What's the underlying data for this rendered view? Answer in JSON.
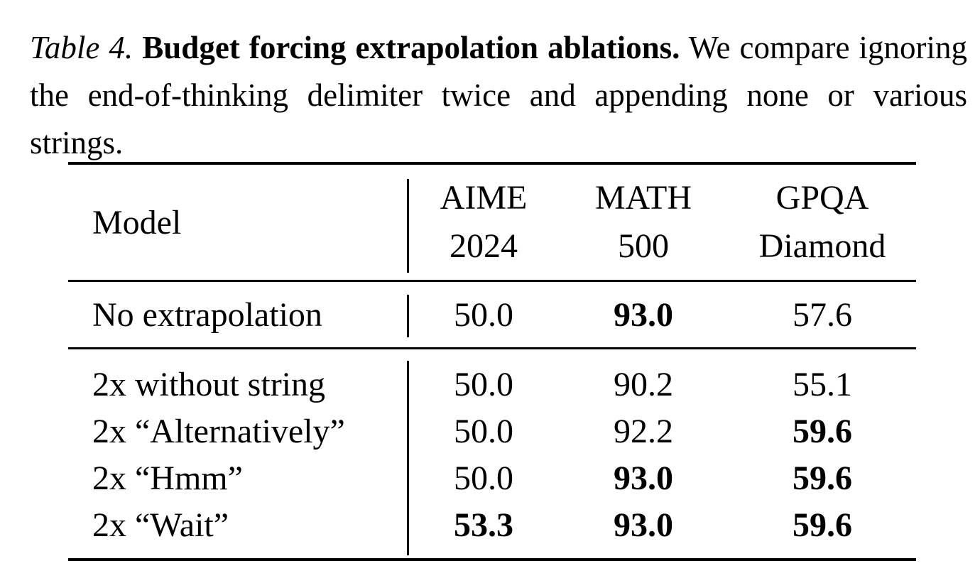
{
  "caption": {
    "label": "Table 4.",
    "title": "Budget forcing extrapolation ablations.",
    "text": "We compare ignoring the end-of-thinking delimiter twice and appending none or various strings."
  },
  "table": {
    "header": {
      "model": "Model",
      "col1_line1": "AIME",
      "col1_line2": "2024",
      "col2_line1": "MATH",
      "col2_line2": "500",
      "col3_line1": "GPQA",
      "col3_line2": "Diamond"
    },
    "rows": [
      {
        "model": "No extrapolation",
        "aime": "50.0",
        "math": "93.0",
        "gpqa": "57.6"
      },
      {
        "model": "2x without string",
        "aime": "50.0",
        "math": "90.2",
        "gpqa": "55.1"
      },
      {
        "model": "2x “Alternatively”",
        "aime": "50.0",
        "math": "92.2",
        "gpqa": "59.6"
      },
      {
        "model": "2x “Hmm”",
        "aime": "50.0",
        "math": "93.0",
        "gpqa": "59.6"
      },
      {
        "model": "2x “Wait”",
        "aime": "53.3",
        "math": "93.0",
        "gpqa": "59.6"
      }
    ]
  }
}
